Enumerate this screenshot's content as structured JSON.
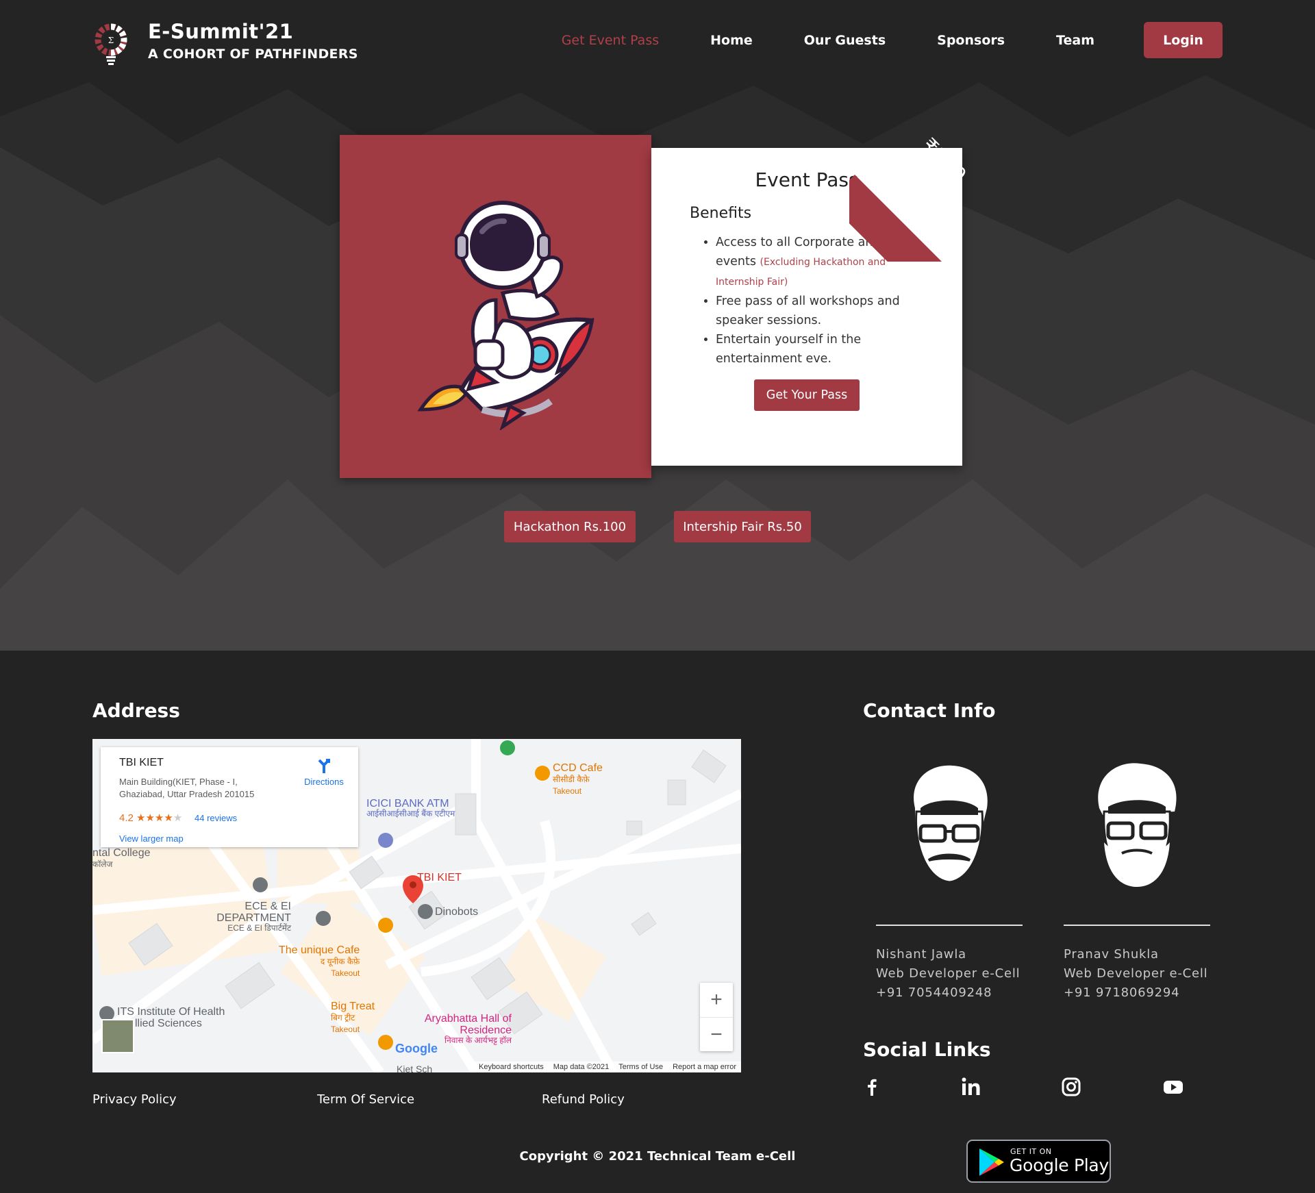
{
  "brand": {
    "title": "E-Summit'21",
    "subtitle": "A COHORT OF PATHFINDERS"
  },
  "nav": {
    "items": [
      {
        "label": "Get Event Pass",
        "active": true
      },
      {
        "label": "Home"
      },
      {
        "label": "Our Guests"
      },
      {
        "label": "Sponsors"
      },
      {
        "label": "Team"
      }
    ],
    "login_label": "Login"
  },
  "pass": {
    "ribbon_price": "₹150",
    "title": "Event Pass",
    "benefits_heading": "Benefits",
    "benefits": [
      {
        "text": "Access to all Corporate and fun events",
        "note": "(Excluding Hackathon and Internship Fair)"
      },
      {
        "text": "Free pass of all workshops and speaker sessions.",
        "note": ""
      },
      {
        "text": "Entertain yourself in the entertainment eve.",
        "note": ""
      }
    ],
    "cta_label": "Get Your Pass",
    "addons": [
      "Hackathon Rs.100",
      "Intership Fair Rs.50"
    ]
  },
  "footer": {
    "address_heading": "Address",
    "contact_heading": "Contact Info",
    "social_heading": "Social Links",
    "policies": [
      "Privacy Policy",
      "Term Of Service",
      "Refund Policy"
    ],
    "copyright": "Copyright © 2021 Technical Team e-Cell",
    "contacts": [
      {
        "name": "Nishant Jawla",
        "role": "Web Developer e-Cell",
        "phone": "+91 7054409248"
      },
      {
        "name": "Pranav Shukla",
        "role": "Web Developer e-Cell",
        "phone": "+91 9718069294"
      }
    ],
    "social_icons": [
      "facebook-icon",
      "linkedin-icon",
      "instagram-icon",
      "youtube-icon"
    ],
    "store_badge": {
      "small": "GET IT ON",
      "big": "Google Play"
    }
  },
  "map": {
    "place": "TBI KIET",
    "address": "Main Building(KIET, Phase - I, Ghaziabad, Uttar Pradesh 201015",
    "rating": "4.2",
    "stars": "★★★★",
    "reviews": "44 reviews",
    "larger_map": "View larger map",
    "directions": "Directions",
    "labels": {
      "ccd": "CCD Cafe",
      "ccd_hi": "सीसीडी कैफ़े",
      "ccd_type": "Takeout",
      "icici": "ICICI BANK ATM",
      "icici_hi": "आईसीआईसीआई बैंक एटीएम",
      "college": "ntal College",
      "college_hi": "कॉलेज",
      "tbi": "TBI KIET",
      "dinobots": "Dinobots",
      "ece": "ECE & EI DEPARTMENT",
      "ece_small": "ECE & EI डिपार्टमेंट",
      "unique": "The unique Cafe",
      "unique_hi": "द यूनीक कैफ़े",
      "unique_type": "Takeout",
      "its": "ITS Institute Of Health",
      "its2": "llied Sciences",
      "bigtreat": "Big Treat",
      "bigtreat_hi": "बिग ट्रीट",
      "bigtreat_type": "Takeout",
      "arya": "Aryabhatta Hall of Residence",
      "arya_hi": "निवास के आर्यभट्ट हॉल",
      "kiet": "Kiet Sch"
    },
    "google": "Google",
    "footer": [
      "Keyboard shortcuts",
      "Map data ©2021",
      "Terms of Use",
      "Report a map error"
    ],
    "zoom_in": "+",
    "zoom_out": "−"
  },
  "colors": {
    "accent": "#a23a44",
    "bg": "#222222"
  }
}
